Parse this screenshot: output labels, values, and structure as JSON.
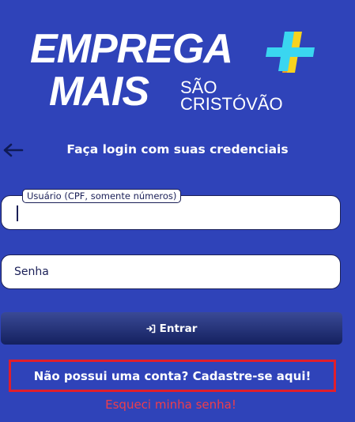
{
  "logo": {
    "line1": "EMPREGA",
    "line2": "MAIS",
    "sub1": "SÃO",
    "sub2": "CRISTÓVÃO",
    "mark_colors": [
      "#3ad6f0",
      "#f7d21e",
      "#f59a1e"
    ]
  },
  "header": {
    "back_icon": "arrow-left-icon",
    "title": "Faça login com suas credenciais"
  },
  "form": {
    "user_label": "Usuário (CPF, somente números)",
    "user_value": "",
    "password_placeholder": "Senha",
    "enter_label": "Entrar",
    "enter_icon": "sign-in-icon"
  },
  "links": {
    "register": "Não possui uma conta? Cadastre-se aqui!",
    "forgot": "Esqueci minha senha!"
  },
  "colors": {
    "background": "#2f43b9",
    "button": "#1e2b73",
    "highlight_border": "#e11e2b",
    "link_red": "#ee3e4b"
  }
}
